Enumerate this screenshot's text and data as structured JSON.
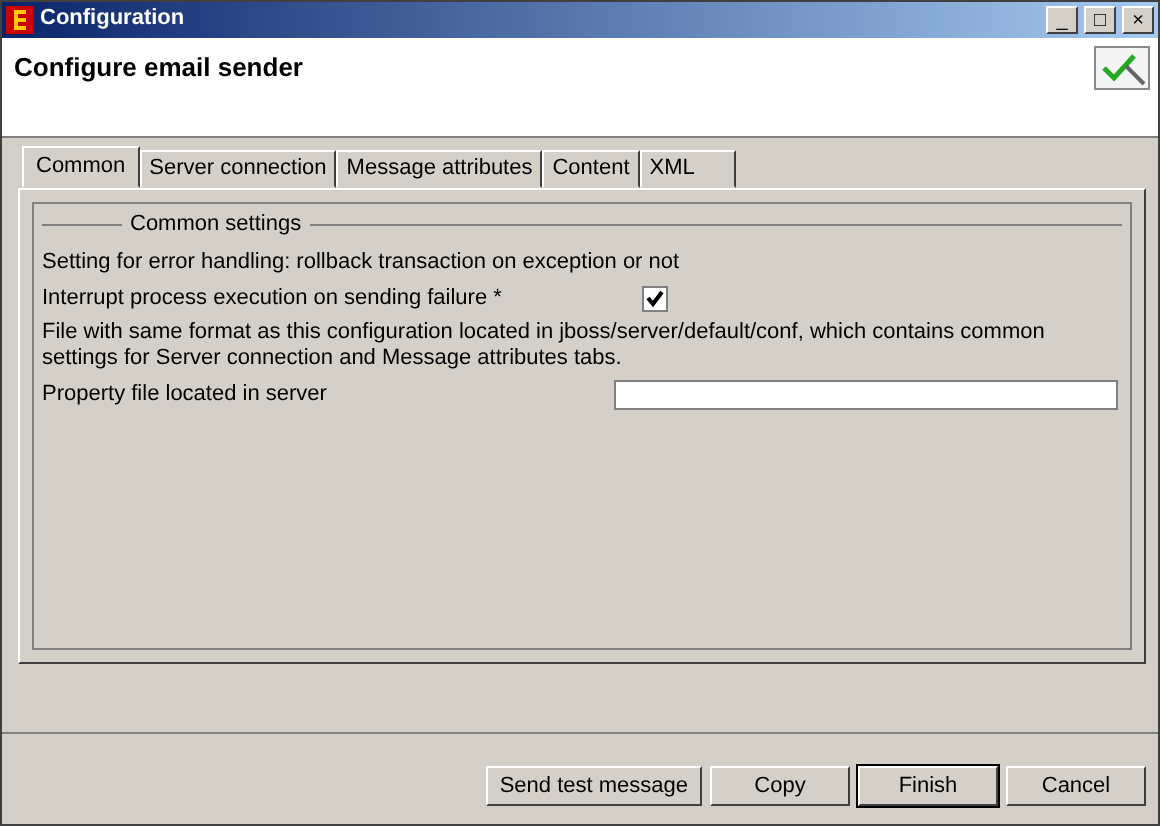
{
  "window": {
    "title": "Configuration",
    "buttons": [
      "_",
      "□",
      "×"
    ]
  },
  "header": {
    "title": "Configure email sender"
  },
  "tabs": [
    {
      "label": "Common",
      "selected": true
    },
    {
      "label": "Server connection",
      "selected": false
    },
    {
      "label": "Message attributes",
      "selected": false
    },
    {
      "label": "Content",
      "selected": false
    },
    {
      "label": "XML",
      "selected": false
    }
  ],
  "group": {
    "title": "Common settings",
    "rows": [
      {
        "kind": "text",
        "text": "Setting for error handling: rollback transaction on exception or not"
      },
      {
        "kind": "checkbox",
        "label": "Interrupt process execution on sending failure *",
        "checked": true
      },
      {
        "kind": "text",
        "text": "File with same format as this configuration located in jboss/server/default/conf, which contains common settings for Server connection and Message attributes tabs."
      },
      {
        "kind": "field",
        "label": "Property file located in server"
      }
    ]
  },
  "buttons": [
    {
      "label": "Send test message",
      "default": false
    },
    {
      "label": "Copy",
      "default": false
    },
    {
      "label": "Finish",
      "default": true
    },
    {
      "label": "Cancel",
      "default": false
    }
  ]
}
